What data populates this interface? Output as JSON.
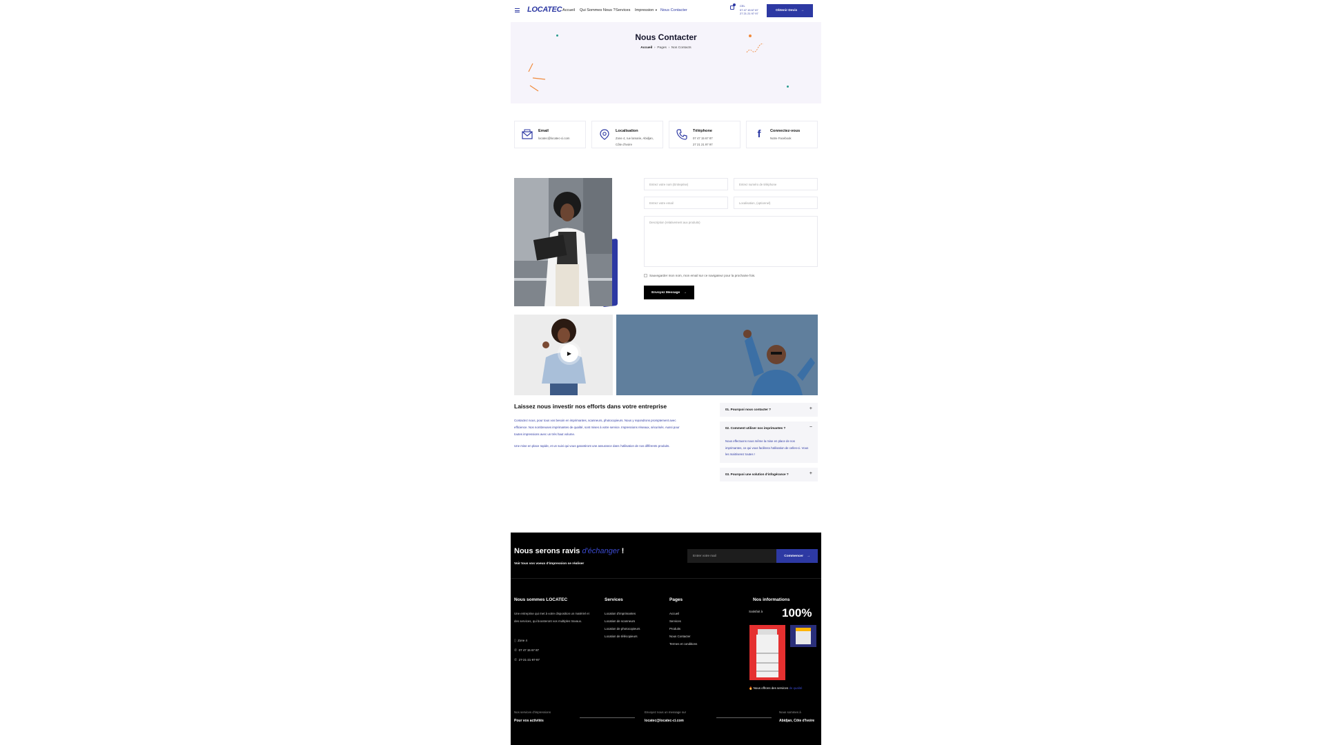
{
  "header": {
    "logo": "LOCATEC",
    "nav": [
      {
        "label": "Accueil"
      },
      {
        "label": "Qui Sommes Nous ?"
      },
      {
        "label": "Services"
      },
      {
        "label": "Impression"
      },
      {
        "label": "Nous Contacter"
      }
    ],
    "phone_label": "CEL",
    "phone_1": "07 47 15 67 87",
    "phone_2": "27 21 21 97 97",
    "cta": "Obtenir Devis"
  },
  "hero": {
    "title": "Nous Contacter",
    "breadcrumb": [
      "Accueil",
      "Pages",
      "Nos Contacts"
    ]
  },
  "cards": [
    {
      "title": "Email",
      "lines": [
        "locatec@locatec-ci.com"
      ],
      "icon": "mail-icon"
    },
    {
      "title": "Localisation",
      "lines": [
        "Zone 4, rue lamarie, Abidjan,",
        "Côte d'Ivoire"
      ],
      "icon": "location-pin-icon"
    },
    {
      "title": "Téléphone",
      "lines": [
        "07 47 15 67 87",
        "27 21 21 97 97"
      ],
      "icon": "phone-icon"
    },
    {
      "title": "Connectez-vous",
      "lines": [
        "Notre Facebook"
      ],
      "icon": "facebook-icon"
    }
  ],
  "form": {
    "name_placeholder": "Entrez votre nom (Entreprise)",
    "phone_placeholder": "Entrez numéro de téléphone",
    "email_placeholder": "Entrez votre email",
    "location_placeholder": "Localisation, (optionnel)",
    "message_placeholder": "Description (relativement aux produits)",
    "checkbox_label": "Sauvegarder mon nom, mon email sur ce navigateur pour la prochaine fois.",
    "submit": "Envoyez Message"
  },
  "about": {
    "title": "Laissez nous investir nos efforts dans votre entreprise",
    "para_1": "Contactez nous, pour tous vos besoin en imprimantes, scanneurs, photocopieurs. Nous y repondrons promptement avec efficience. Nos nombreuses imprimantes de qualité, sont mises à votre service. Impressions réseaux, sécurisés. Aussi pour toutes impressions avec un très haut volume.",
    "para_2": "Une mise en place rapide, et un suivi qui vous garantiront une assurance dans l'utilisation de nos différents produits."
  },
  "faq": [
    {
      "q": "01. Pourquoi nous contacter ?",
      "sign": "+",
      "a": ""
    },
    {
      "q": "02. Comment utiliser nos imprimantes ?",
      "sign": "−",
      "a": "Nous effectuons nous même la mise en place de nos imprimantes, ce qui vous facilitera l'utilisation de celles-ci. Vous les maitriserez toutes !"
    },
    {
      "q": "03. Pourquoi une solution d'infogérance ?",
      "sign": "+",
      "a": ""
    }
  ],
  "footer": {
    "headline_a": "Nous serons ravis ",
    "headline_b": "d'échanger",
    "headline_c": " !",
    "sub": "Voir tous vos voeux d'impression se réaliser",
    "email_placeholder": "Entrer votre mail",
    "subscribe": "Commencer",
    "about_title": "Nous sommes LOCATEC",
    "about_text": "Une entreprise qui met à votre disposition un matériel et des services, qui boosteront vos multiples travaux.",
    "contact": [
      "Zone 4",
      "07 47 15 67 87",
      "27-21-21-97-97"
    ],
    "services_title": "Services",
    "services": [
      "Location d'imprimantes",
      "Location de scanneurs",
      "Location de photocopieurs",
      "Location de télécopieurs"
    ],
    "pages_title": "Pages",
    "pages": [
      "Accueil",
      "Services",
      "Produits",
      "Nous Contacter",
      "Termes et conditions"
    ],
    "info_title": "Nos informations",
    "satisfaction_label": "Satisfait à",
    "satisfaction_value": "100%",
    "offer_a": "Nous offrons des services ",
    "offer_b": "de qualité",
    "bottom": [
      {
        "label": "Nos services d'impressions",
        "value": "Pour vos activités"
      },
      {
        "label": "Envoyez nous un message sur",
        "value": "locatec@locatec-ci.com"
      },
      {
        "label": "Nous sommes à",
        "value": "Abidjan, Côte d'Ivoire"
      }
    ]
  },
  "colors": {
    "brand": "#2d39a3",
    "hero_bg": "#f6f4fb",
    "footer_bg": "#000000"
  }
}
